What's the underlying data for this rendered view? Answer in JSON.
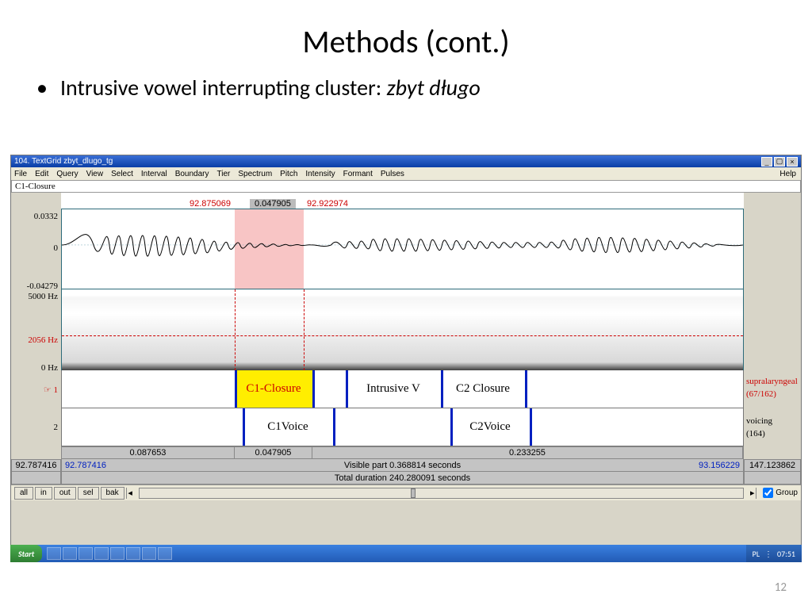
{
  "slide": {
    "title": "Methods (cont.)",
    "bullet_prefix": "Intrusive vowel interrupting cluster: ",
    "bullet_italic": "zbyt długo",
    "number": "12"
  },
  "window": {
    "title": "104. TextGrid zbyt_dlugo_tg",
    "menus": [
      "File",
      "Edit",
      "Query",
      "View",
      "Select",
      "Interval",
      "Boundary",
      "Tier",
      "Spectrum",
      "Pitch",
      "Intensity",
      "Formant",
      "Pulses"
    ],
    "help": "Help",
    "info_label": "C1-Closure"
  },
  "times": {
    "sel_start": "92.875069",
    "sel_dur": "0.047905",
    "sel_end": "92.922974",
    "bottom_left": "92.787416",
    "bottom_vis_left": "92.787416",
    "visible_text": "Visible part 0.368814 seconds",
    "bottom_vis_right": "93.156229",
    "bottom_right": "147.123862",
    "total_text": "Total duration 240.280091 seconds",
    "dur_left": "0.087653",
    "dur_mid": "0.047905",
    "dur_right": "0.233255"
  },
  "waveform": {
    "ymax": "0.0332",
    "yzero": "0",
    "ymin": "-0.04279"
  },
  "spectrogram": {
    "ymax": "5000 Hz",
    "cursor": "2056 Hz",
    "ymin": "0 Hz"
  },
  "tiers": {
    "t1_id": "☞ 1",
    "t1_name": "supralaryngeal",
    "t1_count": "(67/162)",
    "t2_id": "2",
    "t2_name": "voicing",
    "t2_count": "(164)",
    "intervals1": [
      "C1-Closure",
      "Intrusive V",
      "C2 Closure"
    ],
    "intervals2": [
      "C1Voice",
      "C2Voice"
    ]
  },
  "controls": {
    "buttons": [
      "all",
      "in",
      "out",
      "sel",
      "bak"
    ],
    "group": "Group"
  },
  "taskbar": {
    "start": "Start",
    "lang": "PL",
    "clock": "07:51"
  }
}
